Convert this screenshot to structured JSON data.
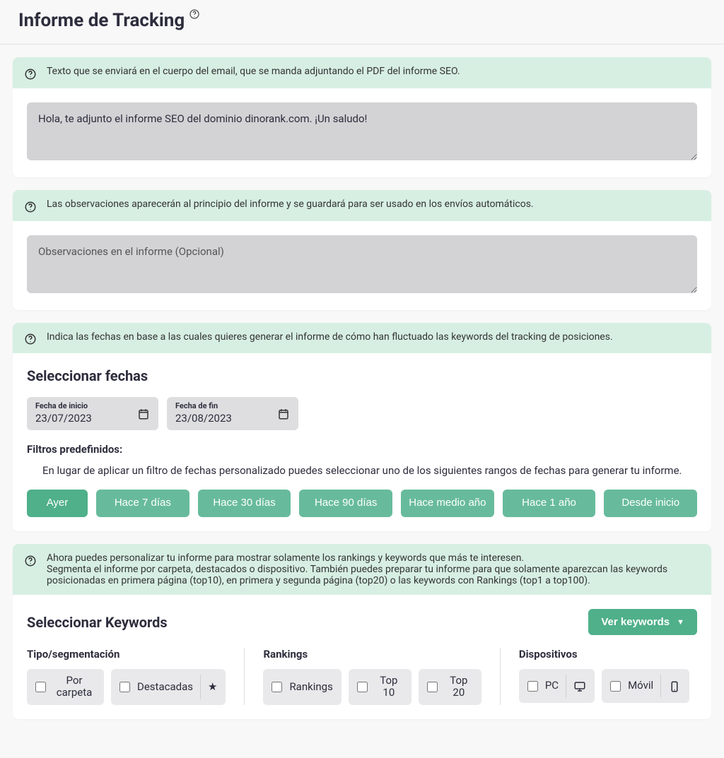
{
  "header": {
    "title": "Informe de Tracking"
  },
  "email_section": {
    "banner": "Texto que se enviará en el cuerpo del email, que se manda adjuntando el PDF del informe SEO.",
    "value": "Hola, te adjunto el informe SEO del dominio dinorank.com. ¡Un saludo!"
  },
  "obs_section": {
    "banner": "Las observaciones aparecerán al principio del informe y se guardará para ser usado en los envíos automáticos.",
    "placeholder": "Observaciones en el informe (Opcional)"
  },
  "dates_section": {
    "banner": "Indica las fechas en base a las cuales quieres generar el informe de cómo han fluctuado las keywords del tracking de posiciones.",
    "title": "Seleccionar fechas",
    "start_label": "Fecha de inicio",
    "start_value": "23/07/2023",
    "end_label": "Fecha de fin",
    "end_value": "23/08/2023",
    "filters_title": "Filtros predefinidos:",
    "filters_help": "En lugar de aplicar un filtro de fechas personalizado puedes seleccionar uno de los siguientes rangos de fechas para generar tu informe.",
    "buttons": {
      "yesterday": "Ayer",
      "d7": "Hace 7 días",
      "d30": "Hace 30 días",
      "d90": "Hace 90 días",
      "half_year": "Hace medio año",
      "year": "Hace 1 año",
      "start": "Desde inicio"
    }
  },
  "keywords_section": {
    "banner_line1": "Ahora puedes personalizar tu informe para mostrar solamente los rankings y keywords que más te interesen.",
    "banner_line2": "Segmenta el informe por carpeta, destacados o dispositivo. También puedes preparar tu informe para que solamente aparezcan las keywords posicionadas en primera página (top10), en primera y segunda página (top20) o las keywords con Rankings (top1 a top100).",
    "title": "Seleccionar Keywords",
    "ver_btn": "Ver keywords",
    "col_seg": "Tipo/segmentación",
    "col_rank": "Rankings",
    "col_dev": "Dispositivos",
    "chips": {
      "por_carpeta": "Por carpeta",
      "destacadas": "Destacadas",
      "rankings": "Rankings",
      "top10": "Top 10",
      "top20": "Top 20",
      "pc": "PC",
      "movil": "Móvil"
    }
  }
}
